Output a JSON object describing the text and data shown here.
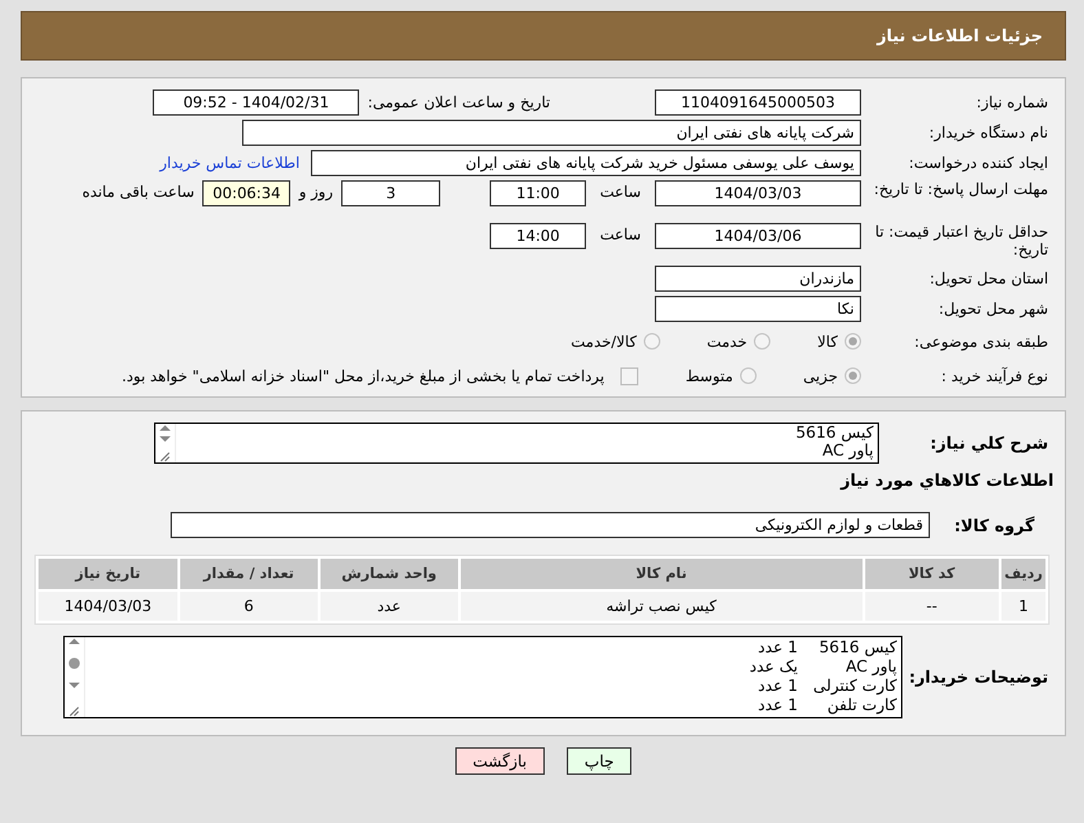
{
  "header": {
    "title": "جزئیات اطلاعات نیاز"
  },
  "details": {
    "need_number": {
      "label": "شماره نیاز:",
      "value": "1104091645000503"
    },
    "announce": {
      "label": "تاریخ و ساعت اعلان عمومی:",
      "value": "1404/02/31 - 09:52"
    },
    "buyer_org": {
      "label": "نام دستگاه خریدار:",
      "value": "شرکت پایانه های نفتی ایران"
    },
    "creator": {
      "label": "ایجاد کننده درخواست:",
      "value": "یوسف علی یوسفی مسئول خرید شرکت پایانه های نفتی ایران",
      "link": "اطلاعات تماس خریدار"
    },
    "reply_deadline": {
      "label": "مهلت ارسال پاسخ: تا تاریخ:",
      "date": "1404/03/03",
      "time_label": "ساعت",
      "time": "11:00",
      "days": "3",
      "days_label": "روز و",
      "remaining": "00:06:34",
      "remaining_label": "ساعت باقی مانده"
    },
    "price_validity": {
      "label": "حداقل تاریخ اعتبار قیمت: تا تاریخ:",
      "date": "1404/03/06",
      "time_label": "ساعت",
      "time": "14:00"
    },
    "province": {
      "label": "استان محل تحویل:",
      "value": "مازندران"
    },
    "city": {
      "label": "شهر محل تحویل:",
      "value": "نکا"
    },
    "category": {
      "label": "طبقه بندی موضوعی:",
      "options": [
        {
          "label": "کالا",
          "selected": true
        },
        {
          "label": "خدمت",
          "selected": false
        },
        {
          "label": "کالا/خدمت",
          "selected": false
        }
      ]
    },
    "process": {
      "label": "نوع فرآیند خرید :",
      "options": [
        {
          "label": "جزیی",
          "selected": true
        },
        {
          "label": "متوسط",
          "selected": false
        }
      ],
      "treasury": {
        "label": "پرداخت تمام یا بخشی از مبلغ خرید،از محل \"اسناد خزانه اسلامی\" خواهد بود.",
        "checked": false
      }
    }
  },
  "goods": {
    "description": {
      "label": "شرح كلي نياز:",
      "lines": [
        "کیس 5616",
        "پاور AC"
      ]
    },
    "heading": "اطلاعات كالاهاي مورد نياز",
    "group": {
      "label": "گروه کالا:",
      "value": "قطعات و لوازم الکترونیکی"
    },
    "table": {
      "columns": [
        "ردیف",
        "کد کالا",
        "نام کالا",
        "واحد شمارش",
        "تعداد / مقدار",
        "تاریخ نیاز"
      ],
      "rows": [
        [
          "1",
          "--",
          "کیس نصب تراشه",
          "عدد",
          "6",
          "1404/03/03"
        ]
      ]
    },
    "notes": {
      "label": "توضیحات خریدار:",
      "lines": [
        {
          "item": "کیس 5616",
          "quantity": "1 عدد"
        },
        {
          "item": "پاور AC",
          "quantity": "یک عدد"
        },
        {
          "item": "کارت کنترلی",
          "quantity": "1 عدد"
        },
        {
          "item": "کارت تلفن",
          "quantity": "1 عدد"
        }
      ]
    }
  },
  "buttons": [
    {
      "label": "چاپ",
      "kind": "print"
    },
    {
      "label": "بازگشت",
      "kind": "back"
    }
  ]
}
